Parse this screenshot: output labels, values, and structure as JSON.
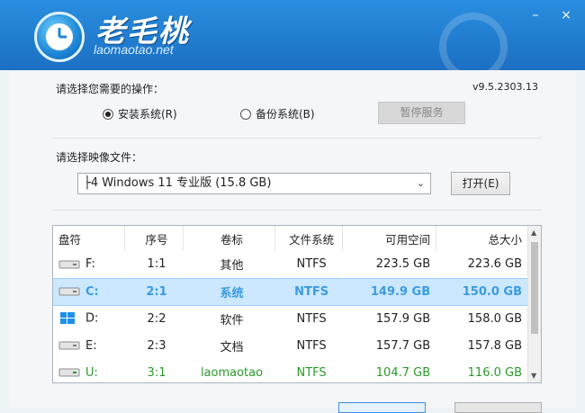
{
  "app": {
    "brand": "老毛桃",
    "url": "laomaotao.net",
    "version": "v9.5.2303.13"
  },
  "window_controls": {
    "minimize": "–",
    "close": "×"
  },
  "operation": {
    "label": "请选择您需要的操作：",
    "install_label": "安装系统(R)",
    "backup_label": "备份系统(B)",
    "selected": "install",
    "pause_button": "暂停服务"
  },
  "image": {
    "label": "请选择映像文件：",
    "selected_value": "├4 Windows 11 专业版 (15.8 GB)",
    "open_button": "打开(E)"
  },
  "table": {
    "headers": [
      "盘符",
      "序号",
      "卷标",
      "文件系统",
      "可用空间",
      "总大小"
    ],
    "rows": [
      {
        "drive": "F:",
        "index": "1:1",
        "label": "其他",
        "fs": "NTFS",
        "free": "223.5 GB",
        "total": "223.6 GB",
        "icon": "hdd-icon",
        "state": "normal"
      },
      {
        "drive": "C:",
        "index": "2:1",
        "label": "系统",
        "fs": "NTFS",
        "free": "149.9 GB",
        "total": "150.0 GB",
        "icon": "hdd-icon",
        "state": "selected"
      },
      {
        "drive": "D:",
        "index": "2:2",
        "label": "软件",
        "fs": "NTFS",
        "free": "157.9 GB",
        "total": "158.0 GB",
        "icon": "windows-icon",
        "state": "normal"
      },
      {
        "drive": "E:",
        "index": "2:3",
        "label": "文档",
        "fs": "NTFS",
        "free": "157.7 GB",
        "total": "157.8 GB",
        "icon": "hdd-icon",
        "state": "normal"
      },
      {
        "drive": "U:",
        "index": "3:1",
        "label": "laomaotao",
        "fs": "NTFS",
        "free": "104.7 GB",
        "total": "116.0 GB",
        "icon": "usb-drive-icon",
        "state": "green"
      }
    ]
  },
  "colors": {
    "header": "#1f7ed1",
    "selected_row": "#cce8ff",
    "selected_text": "#3a9be0",
    "usb_text": "#2a9a2a"
  }
}
